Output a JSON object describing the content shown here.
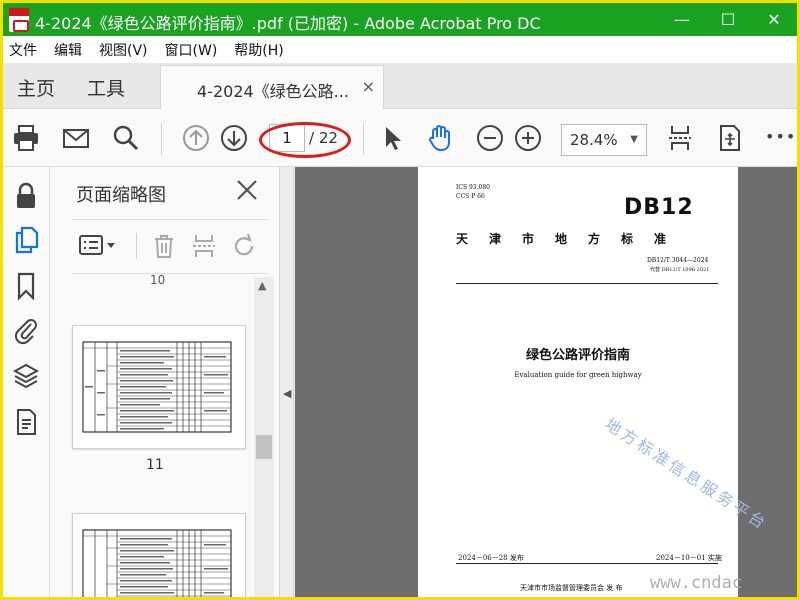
{
  "window": {
    "title": "4-2024《绿色公路评价指南》.pdf  (已加密)  - Adobe Acrobat Pro DC",
    "minimize": "—",
    "maximize": "☐",
    "close": "✕"
  },
  "menubar": {
    "items": [
      "文件",
      "编辑",
      "视图(V)",
      "窗口(W)",
      "帮助(H)"
    ]
  },
  "tabs": {
    "home": "主页",
    "tools": "工具",
    "document_tab": "4-2024《绿色公路...",
    "document_close": "×"
  },
  "toolbar": {
    "current_page": "1",
    "page_total": "/ 22",
    "zoom": "28.4%",
    "zoom_caret": "▼",
    "more": "•••"
  },
  "thumbnails_panel": {
    "title": "页面缩略图",
    "partial_page_number": "10",
    "page_label": "11",
    "scroll_up": "▲"
  },
  "splitter_arrow": "◀",
  "document": {
    "ics": "ICS  93.080",
    "ccs": "CCS  P 66",
    "logo": "DB12",
    "standard_title": "天津市地方标准",
    "standard_no": "DB12/T 3044—2024",
    "replaces": "代替 DB12/T 1096-2021",
    "title_cn": "绿色公路评价指南",
    "title_en": "Evaluation guide for green highway",
    "issue_date": "2024－06－28 发布",
    "impl_date": "2024－10－01 实施",
    "issuer": "天津市市场监督管理委员会    发 布",
    "watermark": "地方标准信息服务平台",
    "site_watermark": "www.cndac"
  },
  "colors": {
    "title_bar": "#1aa321",
    "outer_border": "#f2e000",
    "highlight_oval": "#e01919",
    "hand_tool": "#1473e6"
  },
  "icons": [
    "print-icon",
    "email-icon",
    "search-icon",
    "page-up-icon",
    "page-down-icon",
    "select-cursor-icon",
    "hand-tool-icon",
    "zoom-out-icon",
    "zoom-in-icon",
    "fit-page-icon",
    "scroll-mode-icon",
    "lock-icon",
    "pages-icon",
    "bookmark-icon",
    "attachment-icon",
    "layers-icon",
    "document-icon"
  ]
}
